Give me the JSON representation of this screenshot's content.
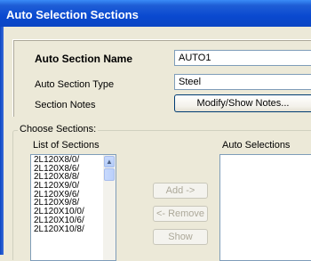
{
  "window": {
    "title": "Auto Selection Sections"
  },
  "header": {
    "name_label": "Auto Section Name",
    "name_value": "AUTO1",
    "type_label": "Auto Section Type",
    "type_value": "Steel",
    "notes_label": "Section Notes",
    "notes_button": "Modify/Show Notes..."
  },
  "choose": {
    "group_label": "Choose Sections:",
    "list_label": "List of Sections",
    "auto_label": "Auto Selections",
    "sections": [
      "2L120X8/0/",
      "2L120X8/6/",
      "2L120X8/8/",
      "2L120X9/0/",
      "2L120X9/6/",
      "2L120X9/8/",
      "2L120X10/0/",
      "2L120X10/6/",
      "2L120X10/8/"
    ],
    "add_button": "Add ->",
    "remove_button": "<- Remove",
    "show_button": "Show"
  },
  "icons": {
    "scroll_up": "scroll-up-arrow-icon"
  }
}
